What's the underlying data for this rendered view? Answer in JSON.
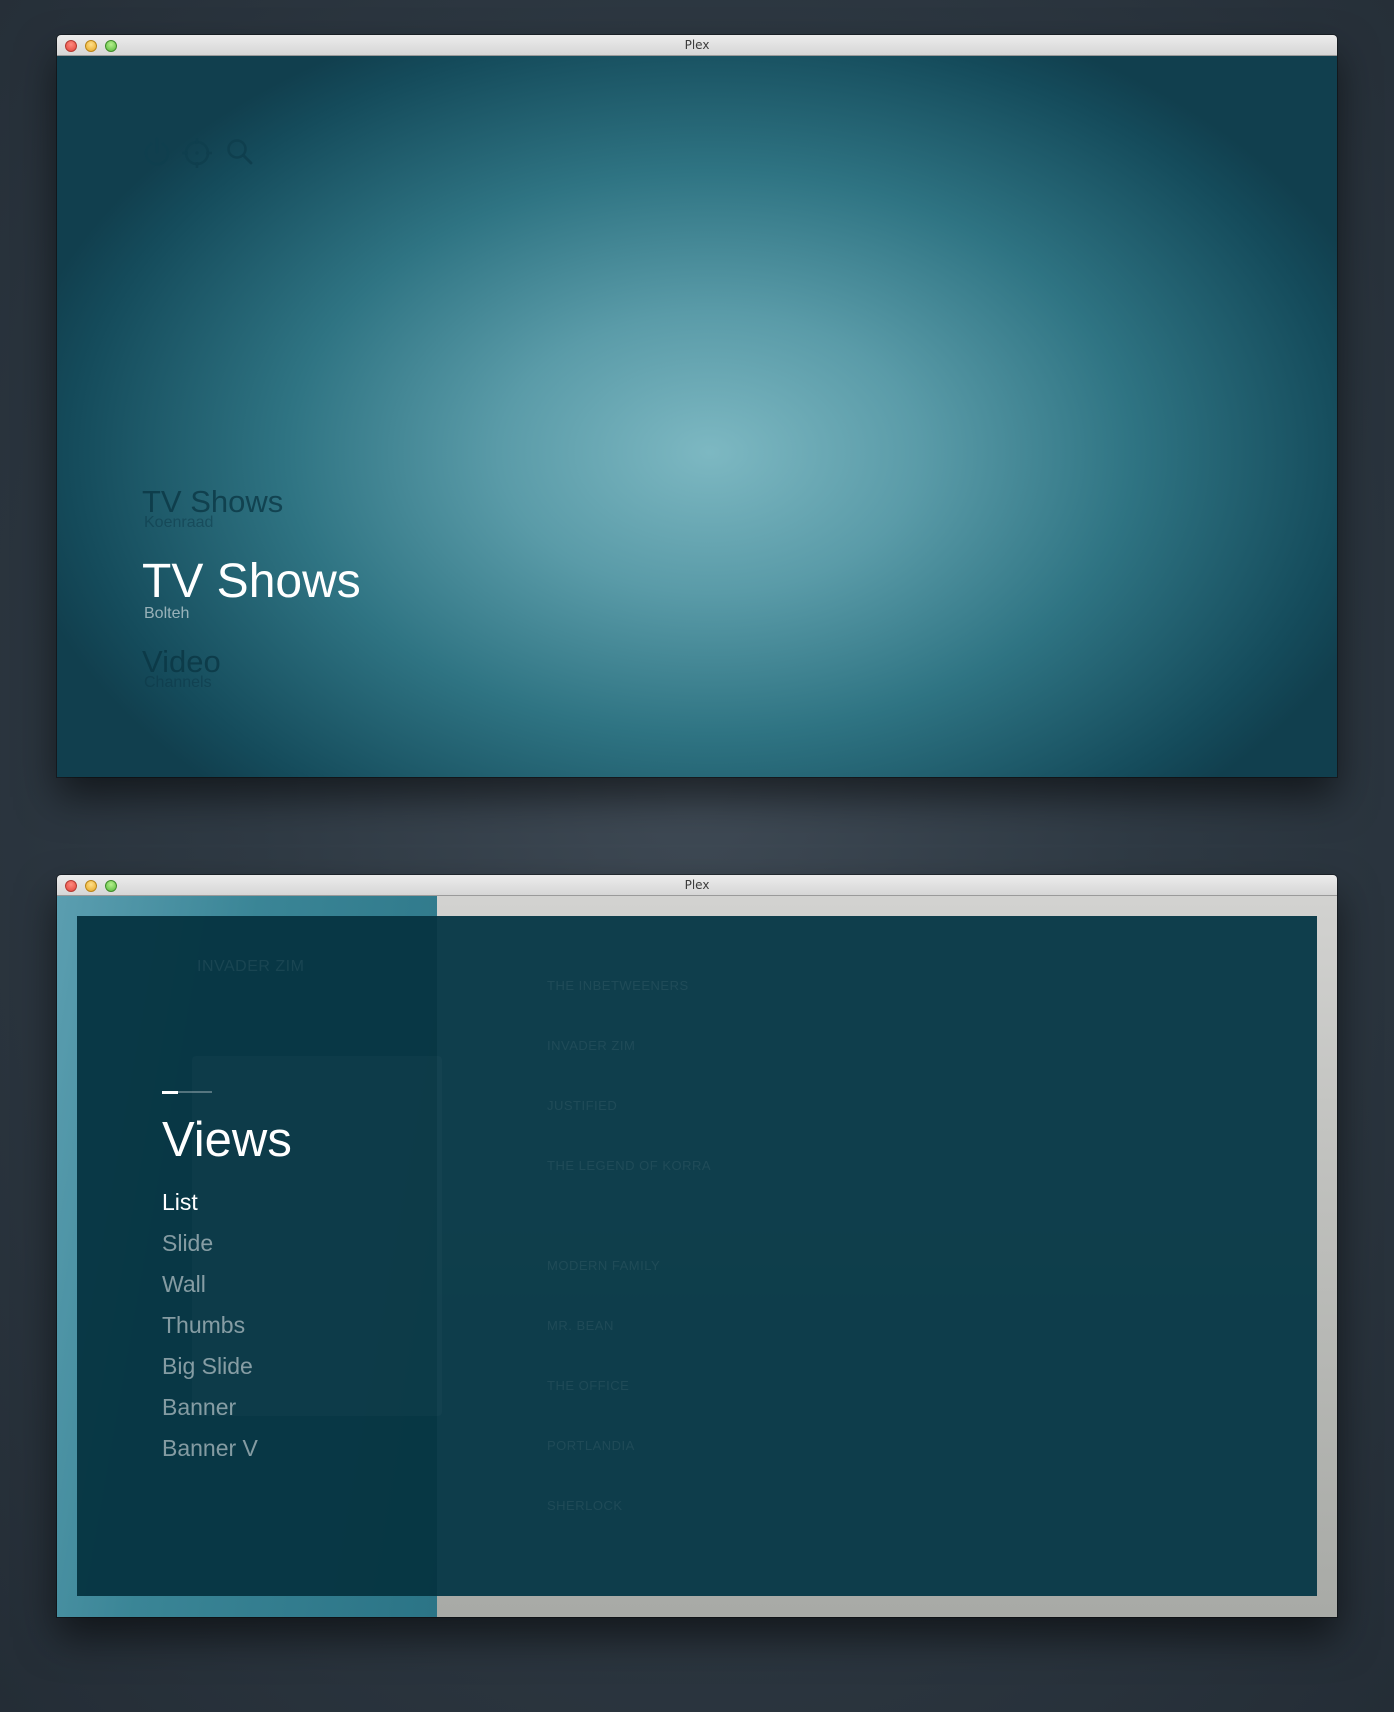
{
  "window1": {
    "title": "Plex",
    "sections": [
      {
        "title": "TV Shows",
        "subtitle": "Koenraad",
        "state": "dim"
      },
      {
        "title": "TV Shows",
        "subtitle": "Bolteh",
        "state": "active"
      },
      {
        "title": "Video",
        "subtitle": "Channels",
        "state": "dim"
      }
    ]
  },
  "window2": {
    "title": "Plex",
    "background_list": [
      "THE INBETWEENERS",
      "INVADER ZIM",
      "JUSTIFIED",
      "THE LEGEND OF KORRA",
      "MODERN FAMILY",
      "MR. BEAN",
      "THE OFFICE",
      "PORTLANDIA",
      "SHERLOCK"
    ],
    "background_label": "INVADER ZIM",
    "views": {
      "title": "Views",
      "items": [
        "List",
        "Slide",
        "Wall",
        "Thumbs",
        "Big Slide",
        "Banner",
        "Banner V"
      ],
      "selected": "List"
    }
  },
  "colors": {
    "accent": "#ffffff",
    "overlay": "#073847",
    "background_teal": "#3a8596"
  },
  "icons": [
    "power-icon",
    "crosshair-icon",
    "search-icon"
  ]
}
